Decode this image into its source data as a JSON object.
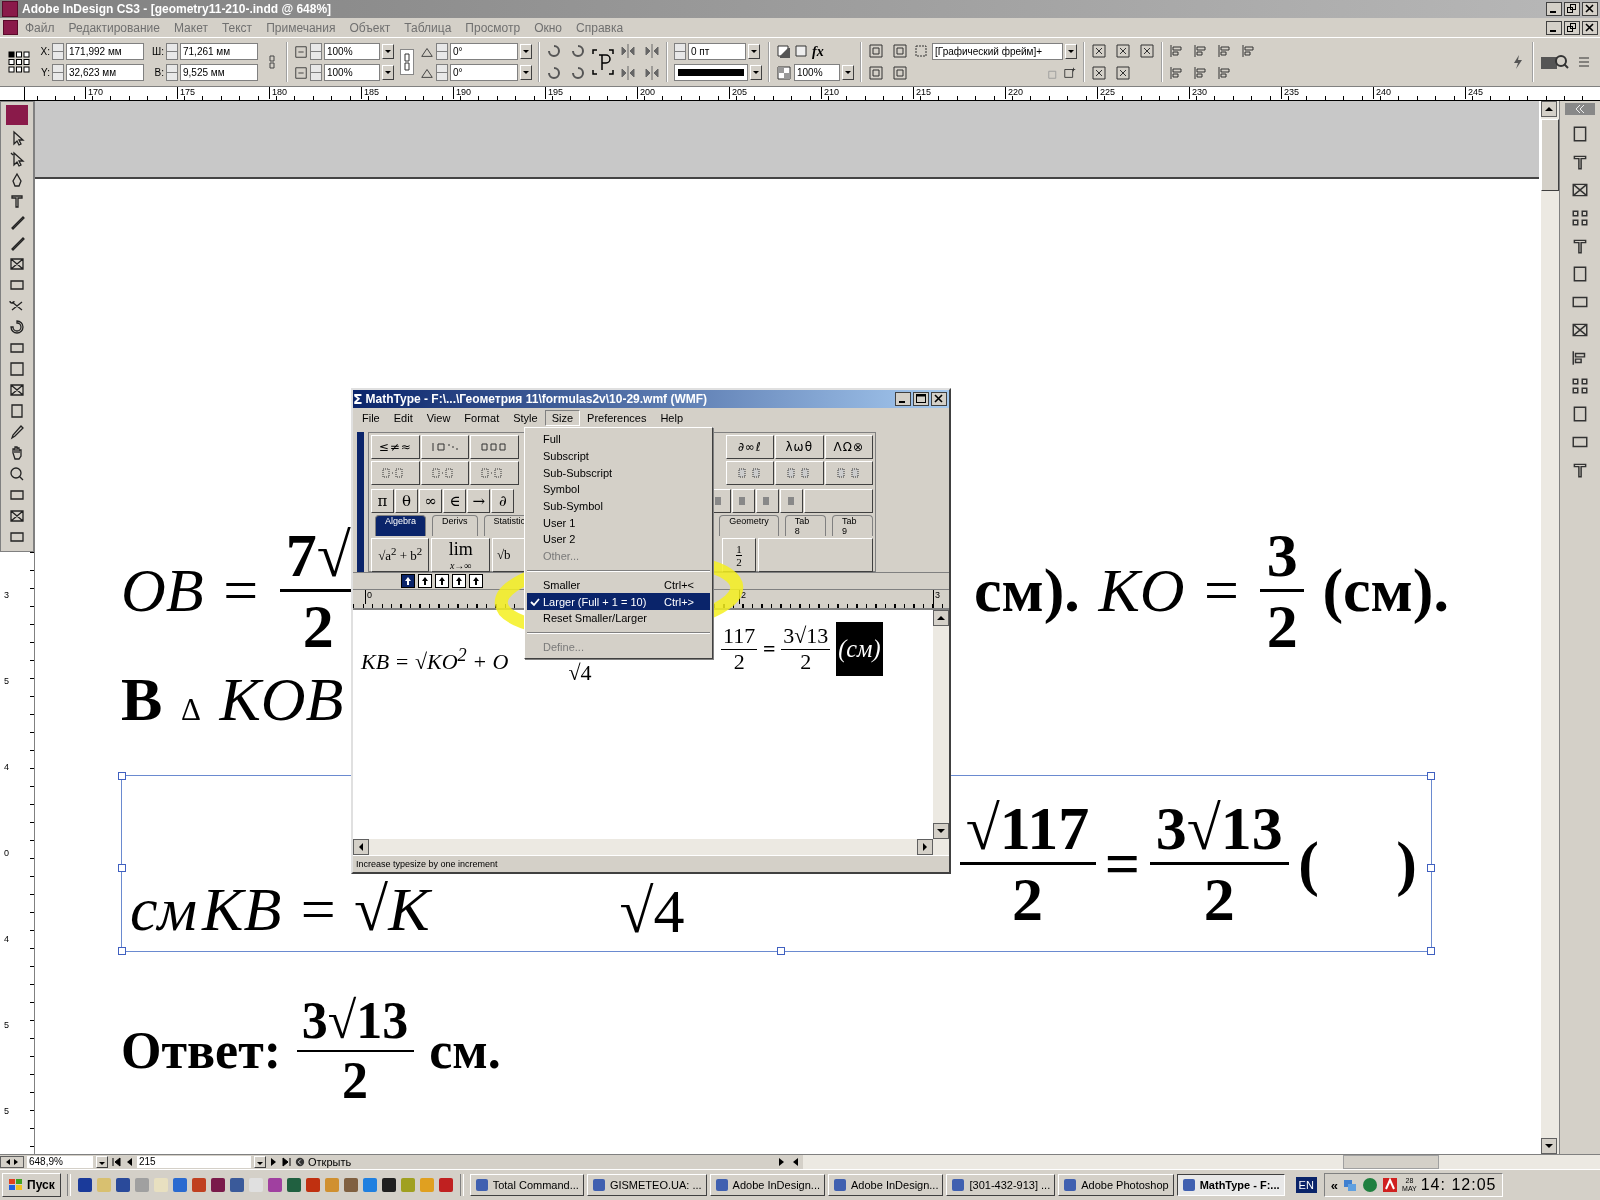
{
  "window": {
    "title": "Adobe InDesign CS3 - [geometry11-210-.indd @ 648%]"
  },
  "menu": [
    "Файл",
    "Редактирование",
    "Макет",
    "Текст",
    "Примечания",
    "Объект",
    "Таблица",
    "Просмотр",
    "Окно",
    "Справка"
  ],
  "control_panel": {
    "position_fields": [
      {
        "label": "X:",
        "value": "171,992 мм"
      },
      {
        "label": "Y:",
        "value": "32,623 мм"
      }
    ],
    "size_fields": [
      {
        "label": "Ш:",
        "value": "71,261 мм"
      },
      {
        "label": "В:",
        "value": "9,525 мм"
      }
    ],
    "scale_fields": [
      "100%",
      "100%"
    ],
    "angle_fields": [
      "0°",
      "0°"
    ],
    "stroke_weight": "0 пт",
    "effects_label": "fx",
    "opacity": "100%",
    "object_style": "[Графический фрейм]+"
  },
  "ruler": [
    "170",
    "175",
    "180",
    "185",
    "190",
    "195",
    "200",
    "205",
    "210",
    "215",
    "220",
    "225",
    "230",
    "235",
    "240",
    "245"
  ],
  "vertical_ruler": [
    "3",
    "5",
    "4",
    "0",
    "4",
    "5",
    "5"
  ],
  "document": {
    "lines": [
      {
        "framed": false,
        "left": [
          {
            "kind": "math",
            "text": "OB ="
          },
          {
            "kind": "frac",
            "num": "7√",
            "den": "2"
          }
        ],
        "right": [
          {
            "kind": "text",
            "text": "см)."
          },
          {
            "kind": "math",
            "text": "KO ="
          },
          {
            "kind": "frac",
            "num": "3",
            "den": "2"
          },
          {
            "kind": "text",
            "text": "(см)."
          }
        ]
      },
      {
        "framed": false,
        "left": [
          {
            "kind": "text",
            "text": "В"
          },
          {
            "kind": "small",
            "text": "Δ"
          },
          {
            "kind": "math",
            "text": "KOB"
          }
        ]
      },
      {
        "framed": true,
        "left": [
          {
            "kind": "math",
            "text": "см"
          },
          {
            "kind": "math",
            "text": "KB = √K"
          }
        ],
        "middle": [
          {
            "kind": "below",
            "text": "√4"
          }
        ],
        "right": [
          {
            "kind": "frac",
            "num": "√117",
            "den": "2"
          },
          {
            "kind": "text",
            "text": "="
          },
          {
            "kind": "frac",
            "num": "3√13",
            "den": "2"
          },
          {
            "kind": "text",
            "text": "(     )"
          }
        ]
      },
      {
        "framed": false,
        "left": [
          {
            "kind": "text",
            "text": "Ответ:"
          },
          {
            "kind": "frac",
            "num": "3√13",
            "den": "2"
          },
          {
            "kind": "text",
            "text": "см."
          }
        ]
      }
    ]
  },
  "mathtype": {
    "icon": "Σ",
    "title": "MathType - F:\\...\\Геометрия 11\\formulas2v\\10-29.wmf (WMF)",
    "menu": [
      {
        "label": "File",
        "selected": false
      },
      {
        "label": "Edit",
        "selected": false
      },
      {
        "label": "View",
        "selected": false
      },
      {
        "label": "Format",
        "selected": false
      },
      {
        "label": "Style",
        "selected": false
      },
      {
        "label": "Size",
        "selected": true
      },
      {
        "label": "Preferences",
        "selected": false
      },
      {
        "label": "Help",
        "selected": false
      }
    ],
    "symbol_buttons": [
      "≤≠≈",
      "∂∞ℓ",
      "λωθ",
      "ΛΩ⊗"
    ],
    "small_symbols": [
      "π",
      "θ",
      "∞",
      "∈",
      "→",
      "∂"
    ],
    "tabs": [
      {
        "label": "Algebra",
        "selected": true
      },
      {
        "label": "Derivs",
        "selected": false
      },
      {
        "label": "Statistic",
        "selected": false
      },
      {
        "label": "Geometry",
        "selected": false
      },
      {
        "label": "Tab 8",
        "selected": false
      },
      {
        "label": "Tab 9",
        "selected": false
      }
    ],
    "templates": [
      {
        "kind": "rich",
        "text": "√a$^{2}$ + b$^{2}$"
      },
      {
        "kind": "limit",
        "text": "lim",
        "sub": "x→∞"
      },
      {
        "kind": "rich",
        "text": "√b"
      },
      {
        "kind": "frac",
        "num": "1",
        "den": "2"
      }
    ],
    "ruler": [
      "0",
      "2",
      "3"
    ],
    "edit": {
      "left": [
        {
          "kind": "math",
          "text": "KB = √KO$^{2}$ + O"
        }
      ],
      "middle": [
        {
          "kind": "below",
          "text": "√4"
        }
      ],
      "right": [
        {
          "kind": "frac",
          "num": "117",
          "den": "2"
        },
        {
          "kind": "text",
          "text": "="
        },
        {
          "kind": "frac",
          "num": "3√13",
          "den": "2"
        },
        {
          "kind": "selected_text",
          "text": "(см)"
        }
      ]
    },
    "status": "Increase typesize by one increment",
    "size_menu": [
      {
        "kind": "item",
        "label": "Full",
        "checked": false,
        "disabled": false,
        "selected": false
      },
      {
        "kind": "item",
        "label": "Subscript",
        "checked": false,
        "disabled": false,
        "selected": false
      },
      {
        "kind": "item",
        "label": "Sub-Subscript",
        "checked": false,
        "disabled": false,
        "selected": false
      },
      {
        "kind": "item",
        "label": "Symbol",
        "checked": false,
        "disabled": false,
        "selected": false
      },
      {
        "kind": "item",
        "label": "Sub-Symbol",
        "checked": false,
        "disabled": false,
        "selected": false
      },
      {
        "kind": "item",
        "label": "User 1",
        "checked": false,
        "disabled": false,
        "selected": false
      },
      {
        "kind": "item",
        "label": "User 2",
        "checked": false,
        "disabled": false,
        "selected": false
      },
      {
        "kind": "item",
        "label": "Other...",
        "checked": false,
        "disabled": true,
        "selected": false
      },
      {
        "kind": "separator"
      },
      {
        "kind": "item",
        "label": "Smaller",
        "shortcut": "Ctrl+<",
        "checked": false,
        "disabled": false,
        "selected": false
      },
      {
        "kind": "item",
        "label": "Larger (Full + 1 = 10)",
        "shortcut": "Ctrl+>",
        "checked": true,
        "disabled": false,
        "selected": true
      },
      {
        "kind": "item",
        "label": "Reset Smaller/Larger",
        "checked": false,
        "disabled": false,
        "selected": false
      },
      {
        "kind": "separator"
      },
      {
        "kind": "item",
        "label": "Define...",
        "checked": false,
        "disabled": true,
        "selected": false
      }
    ]
  },
  "status_bar": {
    "zoom": "648,9%",
    "page": "215",
    "open_label": "Открыть"
  },
  "taskbar": {
    "start": "Пуск",
    "tasks": [
      {
        "label": "Total Command...",
        "selected": false
      },
      {
        "label": "GISMETEO.UA: ...",
        "selected": false
      },
      {
        "label": "Adobe InDesign...",
        "selected": false
      },
      {
        "label": "Adobe InDesign...",
        "selected": false
      },
      {
        "label": "[301-432-913] ...",
        "selected": false
      },
      {
        "label": "Adobe Photoshop",
        "selected": false
      },
      {
        "label": "MathType - F:...",
        "selected": true
      }
    ],
    "language": "EN",
    "expand": "«",
    "day": "28",
    "month": "MAY",
    "time": "14: 12:05"
  }
}
